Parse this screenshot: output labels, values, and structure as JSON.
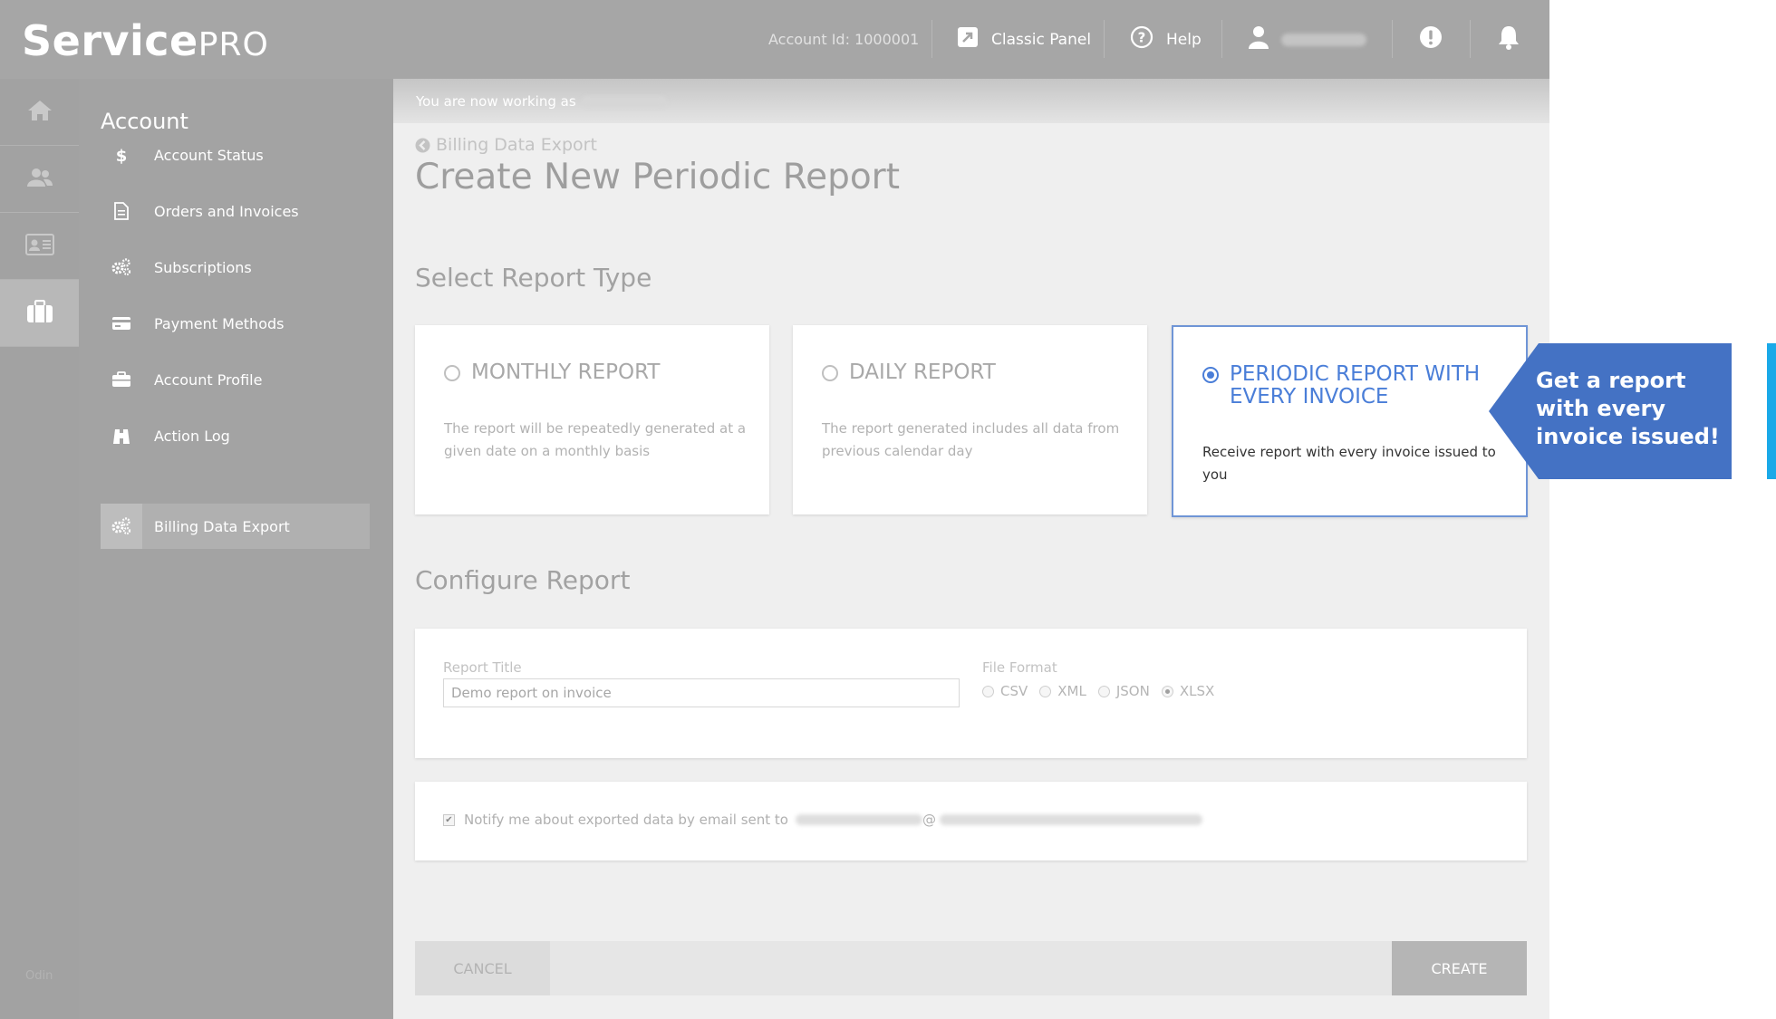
{
  "header": {
    "logo_main": "Service",
    "logo_sub": "PRO",
    "account_id": "Account Id: 1000001",
    "classic_panel": "Classic Panel",
    "help": "Help"
  },
  "rail": {
    "icons": [
      "home-icon",
      "users-icon",
      "contact-card-icon",
      "briefcase-icon"
    ],
    "footer": "Odin"
  },
  "sidebar": {
    "title": "Account",
    "items": [
      {
        "label": "Account Status",
        "icon": "dollar-icon"
      },
      {
        "label": "Orders and Invoices",
        "icon": "document-icon"
      },
      {
        "label": "Subscriptions",
        "icon": "gears-icon"
      },
      {
        "label": "Payment Methods",
        "icon": "credit-card-icon"
      },
      {
        "label": "Account Profile",
        "icon": "briefcase-icon"
      },
      {
        "label": "Action Log",
        "icon": "binoculars-icon"
      },
      {
        "label": "Billing Data Export",
        "icon": "gears-icon",
        "active": true
      }
    ]
  },
  "main": {
    "working_as": "You are now working as",
    "breadcrumb": "Billing Data Export",
    "title": "Create New Periodic Report",
    "select_type_title": "Select Report Type",
    "report_types": [
      {
        "title": "MONTHLY REPORT",
        "desc": "The report will be repeatedly generated at a given date on a monthly basis",
        "selected": false
      },
      {
        "title": "DAILY REPORT",
        "desc": "The report generated includes all data from previous calendar day",
        "selected": false
      },
      {
        "title": "PERIODIC REPORT WITH EVERY INVOICE",
        "desc": "Receive report with every invoice issued to you",
        "selected": true
      }
    ],
    "configure_title": "Configure Report",
    "report_title_label": "Report Title",
    "report_title_value": "Demo report on invoice",
    "file_format_label": "File Format",
    "file_formats": [
      {
        "label": "CSV",
        "selected": false
      },
      {
        "label": "XML",
        "selected": false
      },
      {
        "label": "JSON",
        "selected": false
      },
      {
        "label": "XLSX",
        "selected": true
      }
    ],
    "notify_label": "Notify me about exported data by email sent to",
    "email_at": "@",
    "cancel": "CANCEL",
    "create": "CREATE"
  },
  "callout": {
    "text": "Get a report with every invoice issued!",
    "color": "#4472c4",
    "accent": "#1aa9e8"
  }
}
